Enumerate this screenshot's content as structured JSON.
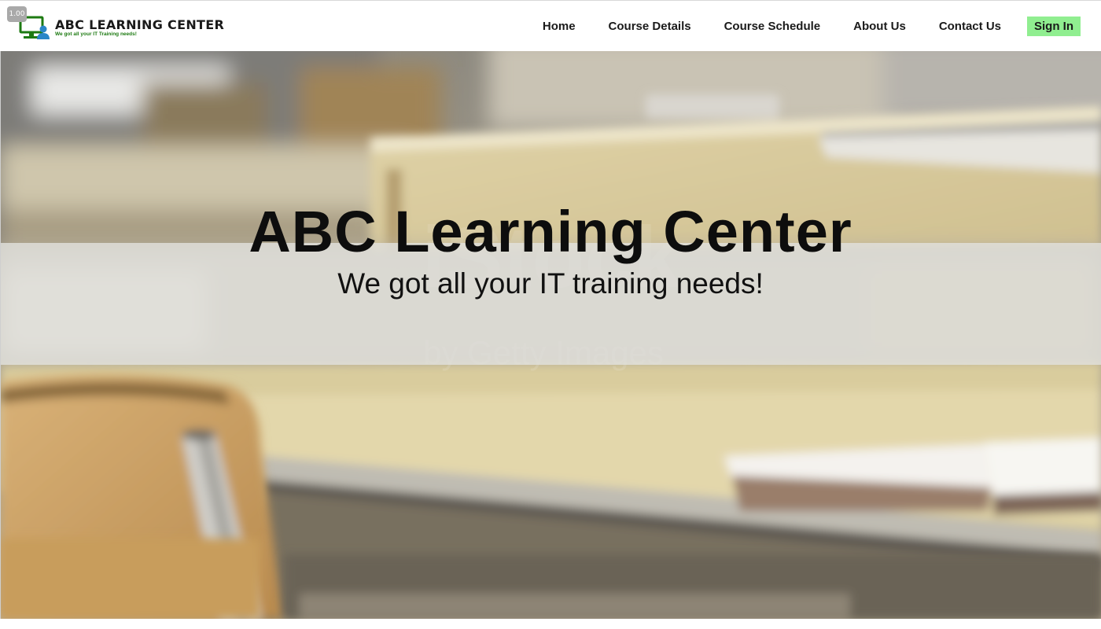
{
  "browser": {
    "zoom_level": "1.00"
  },
  "header": {
    "logo": {
      "icon": "computer-user-icon",
      "title": "ABC LEARNING CENTER",
      "tagline": "We got all your IT Training needs!"
    },
    "nav": [
      {
        "label": "Home"
      },
      {
        "label": "Course Details"
      },
      {
        "label": "Course Schedule"
      },
      {
        "label": "About Us"
      },
      {
        "label": "Contact Us"
      }
    ],
    "sign_in_label": "Sign In"
  },
  "hero": {
    "title": "ABC Learning Center",
    "subtitle": "We got all your IT training needs!",
    "background_image": "blurred-classroom-desk-photo"
  },
  "colors": {
    "signin_background": "#90ee90",
    "logo_green": "#1d7a12",
    "logo_blue": "#2a86c8",
    "band_overlay": "#e2e2de"
  }
}
